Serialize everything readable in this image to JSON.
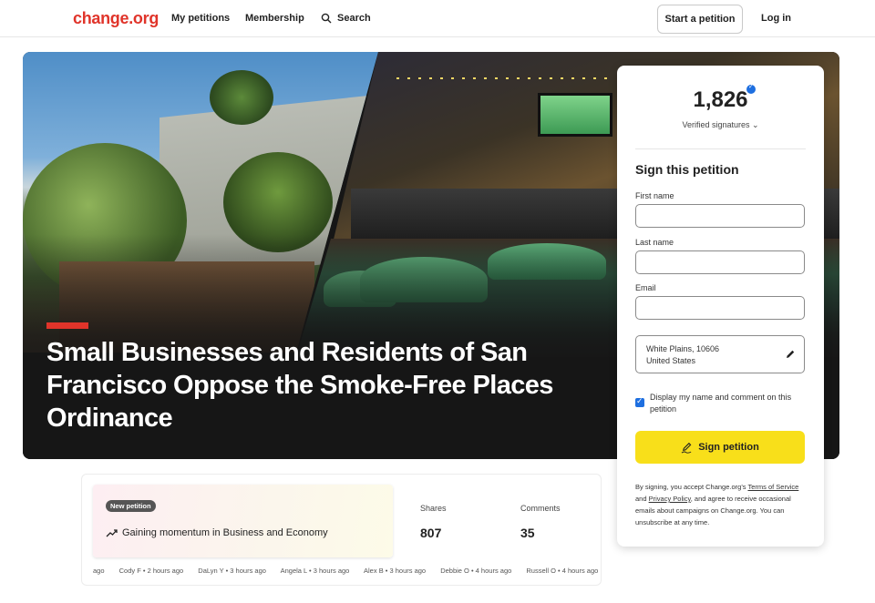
{
  "header": {
    "logo": "change.org",
    "nav": {
      "my_petitions": "My petitions",
      "membership": "Membership",
      "search": "Search"
    },
    "start_petition": "Start a petition",
    "login": "Log in"
  },
  "hero": {
    "title": "Small Businesses and Residents of San Francisco Oppose the Smoke-Free Places Ordinance",
    "accent_color": "#e0342a"
  },
  "sign_card": {
    "count": "1,826",
    "verified_label": "Verified signatures",
    "heading": "Sign this petition",
    "first_name_label": "First name",
    "last_name_label": "Last name",
    "email_label": "Email",
    "location_line1": "White Plains, 10606",
    "location_line2": "United States",
    "display_checkbox_label": "Display my name and comment on this petition",
    "display_checked": true,
    "sign_button": "Sign petition",
    "sign_button_color": "#f8df1a",
    "terms": {
      "prefix": "By signing, you accept Change.org's ",
      "tos": "Terms of Service",
      "mid": " and ",
      "privacy": "Privacy Policy",
      "suffix": ", and agree to receive occasional emails about campaigns on Change.org. You can unsubscribe at any time."
    }
  },
  "stats": {
    "badge": "New petition",
    "momentum": "Gaining momentum in Business and Economy",
    "shares_label": "Shares",
    "shares_value": "807",
    "comments_label": "Comments",
    "comments_value": "35",
    "ticker": [
      "ago",
      "Cody F • 2 hours ago",
      "DaLyn Y • 3 hours ago",
      "Angela L • 3 hours ago",
      "Alex B • 3 hours ago",
      "Debbie O • 4 hours ago",
      "Russell O • 4 hours ago"
    ]
  }
}
